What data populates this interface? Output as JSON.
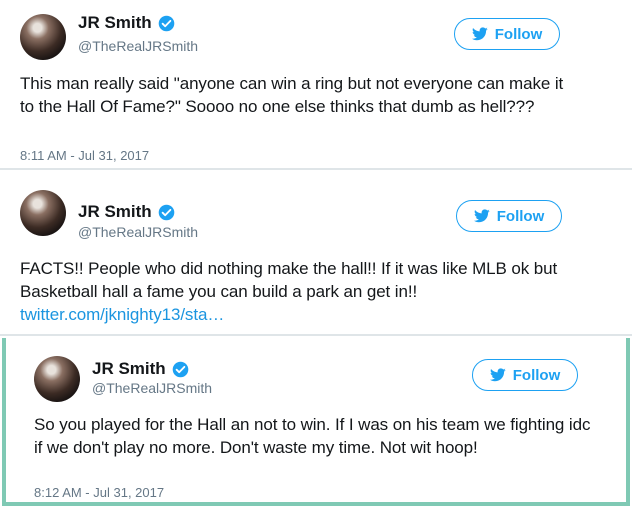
{
  "tweets": [
    {
      "name": "JR Smith",
      "handle": "@TheRealJRSmith",
      "follow_label": "Follow",
      "text": "This man really said \"anyone can win a ring but not everyone can make it to the Hall Of Fame?\" Soooo no one else thinks that dumb as hell???",
      "timestamp": "8:11 AM - Jul 31, 2017"
    },
    {
      "name": "JR Smith",
      "handle": "@TheRealJRSmith",
      "follow_label": "Follow",
      "text": "FACTS!! People who did nothing make the hall!! If it was like MLB ok but Basketball hall a fame you can build a park an get in!! ",
      "link": "twitter.com/jknighty13/sta…"
    },
    {
      "name": "JR Smith",
      "handle": "@TheRealJRSmith",
      "follow_label": "Follow",
      "text": "So you played for the Hall an not to win. If I was on his team we fighting idc if we don't play no more. Don't waste my time. Not wit hoop!",
      "timestamp": "8:12 AM - Jul 31, 2017"
    }
  ],
  "colors": {
    "accent": "#1da1f2",
    "link": "#1b95e0",
    "text": "#14171a",
    "muted": "#657786",
    "border_teal": "#7fc9b4"
  },
  "icons": {
    "verified": "verified-badge-icon",
    "follow": "twitter-bird-icon"
  }
}
